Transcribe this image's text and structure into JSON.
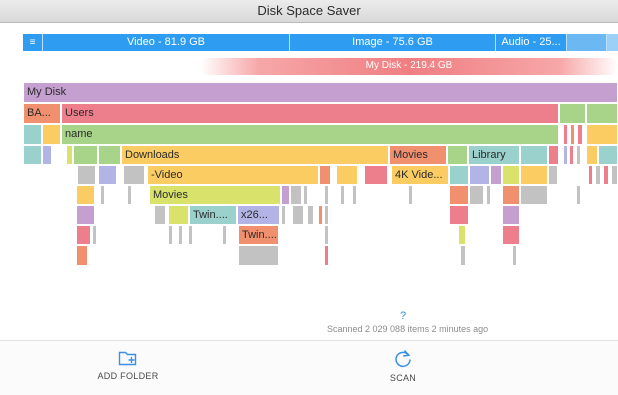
{
  "window": {
    "title": "Disk Space Saver"
  },
  "type_bar": {
    "menu_icon": "menu-icon",
    "segments": [
      {
        "label": "Video - 81.9 GB",
        "color": "#2e9cf0"
      },
      {
        "label": "Image - 75.6 GB",
        "color": "#2e9cf0"
      },
      {
        "label": "Audio - 25...",
        "color": "#2e9cf0"
      }
    ]
  },
  "disk_bar": {
    "label": "My Disk - 219.4 GB",
    "color": "#ef7e82"
  },
  "tree": {
    "my_disk": "My Disk",
    "ba": "BA...",
    "users": "Users",
    "name": "name",
    "downloads": "Downloads",
    "movies": "Movies",
    "library": "Library",
    "video": "-Video",
    "video_4k": "4K Vide...",
    "movies_sub": "Movies",
    "twin1": "Twin....",
    "x26": "x26...",
    "twin2": "Twin...."
  },
  "status": {
    "help": "?",
    "scanned": "Scanned 2 029 088 items 2 minutes ago"
  },
  "toolbar": {
    "add_folder": "ADD FOLDER",
    "add_folder_icon": "add-folder-icon",
    "scan": "SCAN",
    "scan_icon": "refresh-icon",
    "accent": "#3a8fe6"
  }
}
